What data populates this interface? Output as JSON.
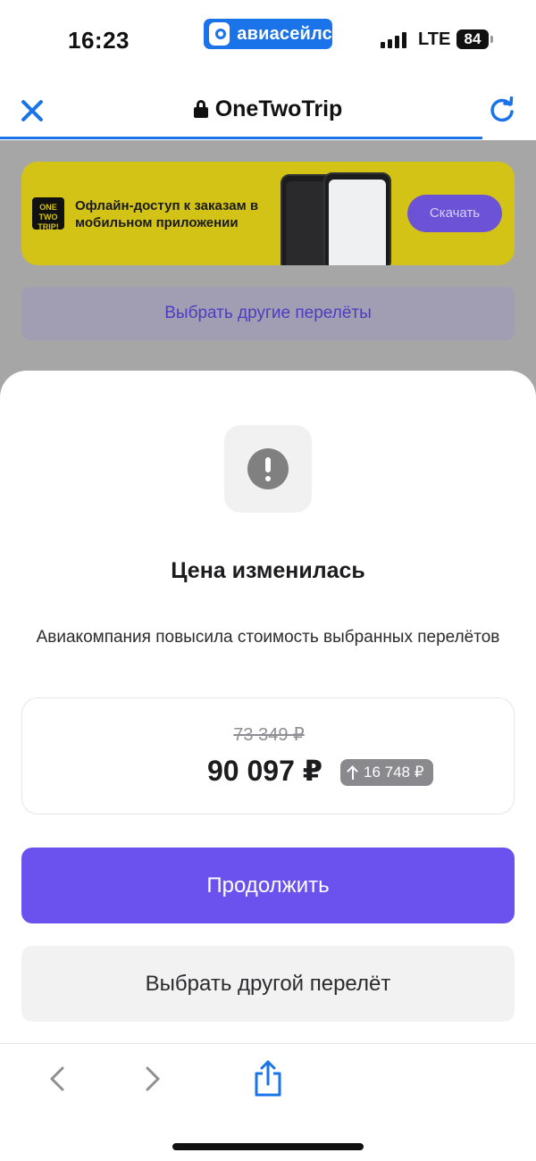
{
  "status_bar": {
    "time": "16:23",
    "app_label": "авиасейлс",
    "network": "LTE",
    "battery": "84"
  },
  "browser": {
    "site_title": "OneTwoTrip"
  },
  "background_page": {
    "banner": {
      "logo_text": "ONE TWO TRIP!",
      "text": "Офлайн-доступ к заказам в мобильном приложении",
      "button_label": "Скачать"
    },
    "other_flights_button": "Выбрать другие перелёты"
  },
  "modal": {
    "title": "Цена изменилась",
    "description": "Авиакомпания повысила стоимость выбранных перелётов",
    "old_price": "73 349 ₽",
    "new_price": "90 097 ₽",
    "increase": "16 748 ₽",
    "continue_button": "Продолжить",
    "choose_other_button": "Выбрать другой перелёт"
  },
  "colors": {
    "accent": "#6b52ee",
    "browser_blue": "#1a73e8",
    "banner_yellow": "#d3c316"
  }
}
